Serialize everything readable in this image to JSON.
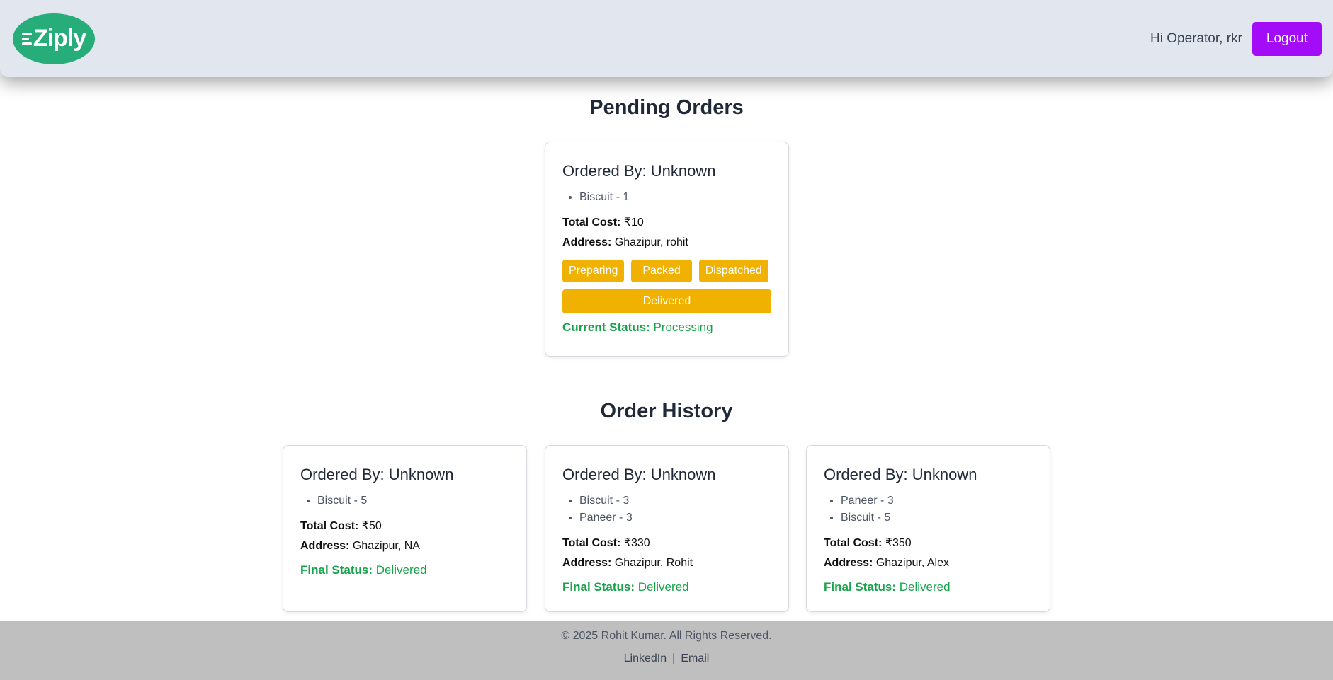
{
  "header": {
    "logo_text": "Ziply",
    "greeting": "Hi Operator, rkr",
    "logout_label": "Logout"
  },
  "pending": {
    "title": "Pending Orders",
    "orders": [
      {
        "ordered_by": "Ordered By: Unknown",
        "items": [
          "Biscuit - 1"
        ],
        "total_label": "Total Cost:",
        "total_value": "₹10",
        "address_label": "Address:",
        "address_value": "Ghazipur, rohit",
        "actions": [
          "Preparing",
          "Packed",
          "Dispatched",
          "Delivered"
        ],
        "status_label": "Current Status:",
        "status_value": "Processing"
      }
    ]
  },
  "history": {
    "title": "Order History",
    "orders": [
      {
        "ordered_by": "Ordered By: Unknown",
        "items": [
          "Biscuit - 5"
        ],
        "total_label": "Total Cost:",
        "total_value": "₹50",
        "address_label": "Address:",
        "address_value": "Ghazipur, NA",
        "status_label": "Final Status:",
        "status_value": "Delivered"
      },
      {
        "ordered_by": "Ordered By: Unknown",
        "items": [
          "Biscuit - 3",
          "Paneer - 3"
        ],
        "total_label": "Total Cost:",
        "total_value": "₹330",
        "address_label": "Address:",
        "address_value": "Ghazipur, Rohit",
        "status_label": "Final Status:",
        "status_value": "Delivered"
      },
      {
        "ordered_by": "Ordered By: Unknown",
        "items": [
          "Paneer - 3",
          "Biscuit - 5"
        ],
        "total_label": "Total Cost:",
        "total_value": "₹350",
        "address_label": "Address:",
        "address_value": "Ghazipur, Alex",
        "status_label": "Final Status:",
        "status_value": "Delivered"
      }
    ]
  },
  "footer": {
    "copyright": "© 2025 Rohit Kumar. All Rights Reserved.",
    "links": [
      "LinkedIn",
      "Email"
    ],
    "separator": "|"
  },
  "colors": {
    "accent": "#a30cf7",
    "status_button": "#f0b100",
    "status_text": "#16a34a",
    "logo_bg": "#27ad7a"
  }
}
